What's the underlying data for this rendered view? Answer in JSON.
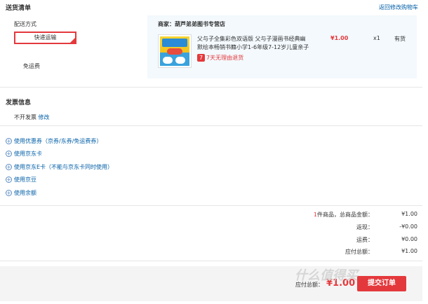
{
  "shipping": {
    "title": "送货清单",
    "back_link": "返回修改购物车",
    "method_label": "配送方式",
    "method_value": "快递运输",
    "free_shipping": "免运费",
    "store": "商家：葫芦弟弟图书专营店",
    "product": {
      "title_line1": "父与子全集彩色双语版 父与子漫画书经典幽",
      "title_line2": "默绘本畅销书籍小学1-6年级7-12岁儿童亲子",
      "price": "¥1.00",
      "qty": "x1",
      "stock": "有货",
      "return_policy": "7天无理由退货",
      "return_icon_text": "7"
    }
  },
  "invoice": {
    "title": "发票信息",
    "value": "不开发票",
    "edit": "修改"
  },
  "coupons": [
    "使用优惠券（京券/东券/免运费券）",
    "使用京东卡",
    "使用京东E卡（不能与京东卡同时使用）",
    "使用京豆",
    "使用余额"
  ],
  "summary": {
    "count_prefix": "1",
    "count_suffix": "件商品，总商品金额：",
    "total": "¥1.00",
    "rebate_label": "返现：",
    "rebate": "-¥0.00",
    "shipping_label": "运费：",
    "shipping": "¥0.00",
    "due_label": "应付总额：",
    "due": "¥1.00"
  },
  "footer": {
    "pay_label": "应付总额：",
    "pay_amount": "¥1.00",
    "submit": "提交订单",
    "watermark": "什么值得买"
  },
  "colors": {
    "accent": "#e4393c",
    "link": "#005ea7",
    "light_bg": "#f3f9fd"
  }
}
